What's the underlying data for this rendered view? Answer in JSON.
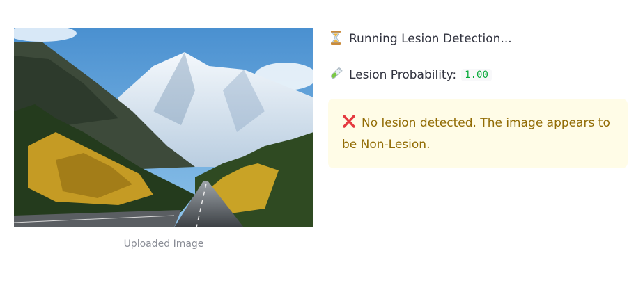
{
  "image": {
    "caption": "Uploaded Image",
    "alt": "mountain-road-photo"
  },
  "status": {
    "running_text": "Running Lesion Detection...",
    "running_icon": "hourglass-icon",
    "probability_label": "Lesion Probability:",
    "probability_icon": "test-tube-icon",
    "probability_value": "1.00"
  },
  "alert": {
    "icon": "cross-mark-icon",
    "text": "No lesion detected. The image appears to be Non-Lesion.",
    "background": "#fffce7",
    "text_color": "#926c05"
  }
}
